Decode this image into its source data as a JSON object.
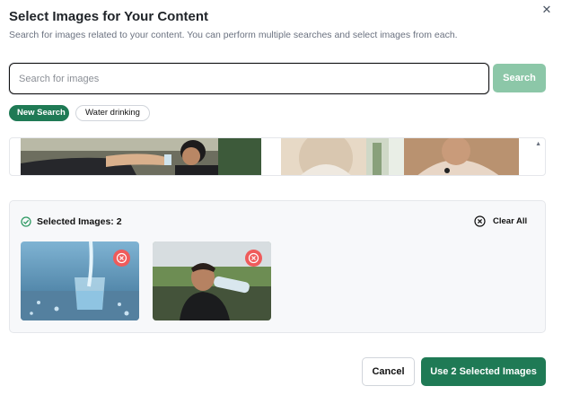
{
  "dialog": {
    "title": "Select Images for Your Content",
    "subtitle": "Search for images related to your content. You can perform multiple searches and select images from each.",
    "close_icon": "close-icon"
  },
  "search": {
    "placeholder": "Search for images",
    "value": "",
    "button_label": "Search"
  },
  "searches": {
    "new_search_label": "New Search",
    "queries": [
      "Water drinking"
    ]
  },
  "results": {
    "images": [
      {
        "name": "man-pouring-water-for-child"
      },
      {
        "name": "woman-drinking-water"
      },
      {
        "name": "woman-in-knit-sweater"
      }
    ]
  },
  "selected": {
    "label": "Selected Images: 2",
    "clear_all_label": "Clear All",
    "images": [
      {
        "name": "water-pouring-into-glass"
      },
      {
        "name": "man-drinking-from-bottle"
      }
    ]
  },
  "footer": {
    "cancel_label": "Cancel",
    "use_label": "Use 2 Selected Images"
  },
  "colors": {
    "primary": "#1f7a55",
    "primary_light": "#8cc7a8",
    "remove": "#ef5b5b"
  }
}
